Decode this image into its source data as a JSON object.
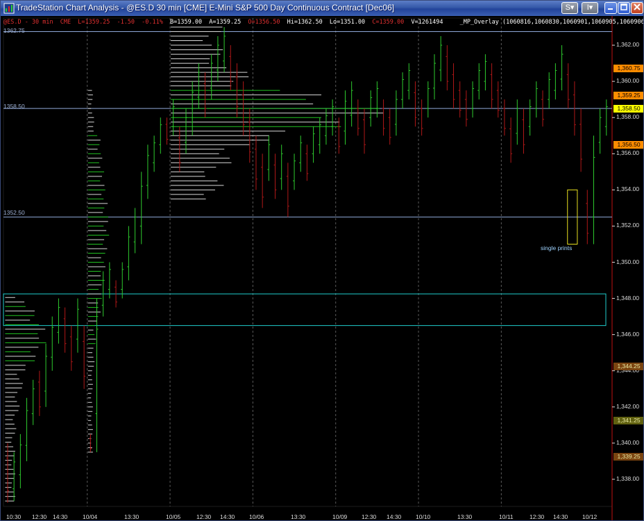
{
  "window": {
    "title": "TradeStation Chart Analysis - @ES.D  30 min  [CME] E-Mini S&P 500 Day Continuous Contract [Dec06]",
    "buttons": {
      "s_label": "S",
      "i_label": "I"
    }
  },
  "infobar": {
    "symbol": "@ES.D - 30 min",
    "exchange": "CME",
    "last": "L=1359.25",
    "change": "-1.50",
    "change_pct": "-0.11%",
    "bid": "B=1359.00",
    "ask": "A=1359.25",
    "open": "O=1356.50",
    "high": "Hi=1362.50",
    "low": "Lo=1351.00",
    "close": "C=1359.00",
    "volume": "V=1261494",
    "indicator": "_MP_Overlay  (1060816,1060830,1060901,1060905,1060906)"
  },
  "annotations": {
    "hline_labels": [
      "1362.75",
      "1358.50",
      "1352.50"
    ],
    "single_prints": "single prints"
  },
  "colors": {
    "up_bar": "#2ecc2e",
    "down_bar": "#b01818",
    "profile_gray": "#d8d8d8",
    "profile_green": "#22c422",
    "hline": "#8fa8d8",
    "box_cyan": "#1fcfcf",
    "box_yellow": "#e8e020",
    "tag_orange": "#ff8c00",
    "tag_yellow": "#ffff00",
    "tag_olive": "#606010",
    "tag_brown": "#7a4410"
  },
  "chart_data": {
    "type": "candlestick",
    "ylim": [
      1336.5,
      1363.5
    ],
    "y_ticks": [
      "1,362.00",
      "1,360.00",
      "1,358.00",
      "1,356.00",
      "1,354.00",
      "1,352.00",
      "1,350.00",
      "1,348.00",
      "1,346.00",
      "1,344.00",
      "1,342.00",
      "1,340.00",
      "1,338.00"
    ],
    "x_ticks": [
      "10:30",
      "12:30",
      "14:30",
      "10/04",
      "13:30",
      "10/05",
      "12:30",
      "14:30",
      "10/06",
      "13:30",
      "10/09",
      "12:30",
      "14:30",
      "10/10",
      "13:30",
      "10/11",
      "12:30",
      "14:30",
      "10/12"
    ],
    "day_separators": [
      "10/04",
      "10/05",
      "10/06",
      "10/09",
      "10/10",
      "10/11"
    ],
    "horizontal_lines": [
      1362.75,
      1358.5,
      1352.5
    ],
    "price_tags": [
      {
        "label": "1,360.75",
        "value": 1360.75,
        "color": "orange"
      },
      {
        "label": "1,359.25",
        "value": 1359.25,
        "color": "orange"
      },
      {
        "label": "1,358.50",
        "value": 1358.5,
        "color": "yellow"
      },
      {
        "label": "1,356.50",
        "value": 1356.5,
        "color": "orange"
      },
      {
        "label": "1,344.25",
        "value": 1344.25,
        "color": "brown"
      },
      {
        "label": "1,341.25",
        "value": 1341.25,
        "color": "olive"
      },
      {
        "label": "1,339.25",
        "value": 1339.25,
        "color": "brown"
      }
    ],
    "zones": [
      {
        "kind": "cyan",
        "y_low": 1346.5,
        "y_high": 1348.25,
        "bar_from": 0,
        "bar_to": 96
      },
      {
        "kind": "single-prints",
        "y_low": 1351.0,
        "y_high": 1354.0,
        "bar_from": 88,
        "bar_to": 89
      }
    ],
    "bars": [
      {
        "h": 1340,
        "l": 1336.7,
        "d": -1
      },
      {
        "h": 1339.5,
        "l": 1336.8,
        "d": 1
      },
      {
        "h": 1340.5,
        "l": 1337.5,
        "d": 1
      },
      {
        "h": 1342.5,
        "l": 1339,
        "d": 1
      },
      {
        "h": 1343.5,
        "l": 1341,
        "d": 1
      },
      {
        "h": 1344,
        "l": 1341.5,
        "d": -1
      },
      {
        "h": 1345.5,
        "l": 1342,
        "d": 1
      },
      {
        "h": 1347,
        "l": 1344,
        "d": 1
      },
      {
        "h": 1348,
        "l": 1345.5,
        "d": 1
      },
      {
        "h": 1347.5,
        "l": 1345,
        "d": -1
      },
      {
        "h": 1346.5,
        "l": 1344,
        "d": -1
      },
      {
        "h": 1348,
        "l": 1345,
        "d": 1
      },
      {
        "h": 1346.5,
        "l": 1343,
        "d": -1
      },
      {
        "h": 1340.5,
        "l": 1339.5,
        "d": -1
      },
      {
        "h": 1348,
        "l": 1339.5,
        "d": 1
      },
      {
        "h": 1349.5,
        "l": 1347,
        "d": 1
      },
      {
        "h": 1350,
        "l": 1348,
        "d": 1
      },
      {
        "h": 1349,
        "l": 1347.5,
        "d": -1
      },
      {
        "h": 1350,
        "l": 1348,
        "d": 1
      },
      {
        "h": 1352,
        "l": 1349,
        "d": 1
      },
      {
        "h": 1353,
        "l": 1350.5,
        "d": 1
      },
      {
        "h": 1355,
        "l": 1351,
        "d": 1
      },
      {
        "h": 1356.5,
        "l": 1353.5,
        "d": 1
      },
      {
        "h": 1357,
        "l": 1355,
        "d": 1
      },
      {
        "h": 1358,
        "l": 1356,
        "d": 1
      },
      {
        "h": 1358,
        "l": 1356.5,
        "d": -1
      },
      {
        "h": 1359,
        "l": 1357,
        "d": 1
      },
      {
        "h": 1357.5,
        "l": 1355,
        "d": -1
      },
      {
        "h": 1358.5,
        "l": 1356,
        "d": 1
      },
      {
        "h": 1360,
        "l": 1357,
        "d": 1
      },
      {
        "h": 1361,
        "l": 1358.5,
        "d": 1
      },
      {
        "h": 1360.5,
        "l": 1358,
        "d": -1
      },
      {
        "h": 1361.5,
        "l": 1359,
        "d": 1
      },
      {
        "h": 1362.5,
        "l": 1360,
        "d": 1
      },
      {
        "h": 1363,
        "l": 1360.5,
        "d": 1
      },
      {
        "h": 1362,
        "l": 1359.5,
        "d": -1
      },
      {
        "h": 1361,
        "l": 1358,
        "d": -1
      },
      {
        "h": 1360,
        "l": 1357,
        "d": -1
      },
      {
        "h": 1358.5,
        "l": 1355.5,
        "d": -1
      },
      {
        "h": 1357,
        "l": 1354,
        "d": -1
      },
      {
        "h": 1356,
        "l": 1353,
        "d": -1
      },
      {
        "h": 1357,
        "l": 1354.5,
        "d": 1
      },
      {
        "h": 1356,
        "l": 1353.5,
        "d": -1
      },
      {
        "h": 1356.5,
        "l": 1354,
        "d": 1
      },
      {
        "h": 1355.5,
        "l": 1352.5,
        "d": -1
      },
      {
        "h": 1356,
        "l": 1354,
        "d": 1
      },
      {
        "h": 1357,
        "l": 1355,
        "d": 1
      },
      {
        "h": 1356.5,
        "l": 1354.5,
        "d": -1
      },
      {
        "h": 1357.5,
        "l": 1355.5,
        "d": 1
      },
      {
        "h": 1358,
        "l": 1356,
        "d": 1
      },
      {
        "h": 1358.5,
        "l": 1356.5,
        "d": 1
      },
      {
        "h": 1359,
        "l": 1357,
        "d": 1
      },
      {
        "h": 1358,
        "l": 1356,
        "d": -1
      },
      {
        "h": 1359.5,
        "l": 1356.5,
        "d": 1
      },
      {
        "h": 1360,
        "l": 1357.5,
        "d": 1
      },
      {
        "h": 1359,
        "l": 1357,
        "d": -1
      },
      {
        "h": 1358.5,
        "l": 1356,
        "d": -1
      },
      {
        "h": 1359.5,
        "l": 1357.5,
        "d": 1
      },
      {
        "h": 1360,
        "l": 1358,
        "d": 1
      },
      {
        "h": 1359,
        "l": 1357,
        "d": -1
      },
      {
        "h": 1358.5,
        "l": 1356.5,
        "d": -1
      },
      {
        "h": 1359.5,
        "l": 1357,
        "d": 1
      },
      {
        "h": 1360.5,
        "l": 1358.5,
        "d": 1
      },
      {
        "h": 1361,
        "l": 1359,
        "d": 1
      },
      {
        "h": 1360,
        "l": 1357.5,
        "d": -1
      },
      {
        "h": 1359,
        "l": 1357,
        "d": -1
      },
      {
        "h": 1360,
        "l": 1358,
        "d": 1
      },
      {
        "h": 1361.5,
        "l": 1359,
        "d": 1
      },
      {
        "h": 1362.5,
        "l": 1360,
        "d": 1
      },
      {
        "h": 1362,
        "l": 1359.5,
        "d": -1
      },
      {
        "h": 1361,
        "l": 1358.5,
        "d": -1
      },
      {
        "h": 1360,
        "l": 1358,
        "d": -1
      },
      {
        "h": 1359.5,
        "l": 1357.5,
        "d": -1
      },
      {
        "h": 1360,
        "l": 1358,
        "d": 1
      },
      {
        "h": 1361,
        "l": 1359,
        "d": 1
      },
      {
        "h": 1361.5,
        "l": 1359.5,
        "d": 1
      },
      {
        "h": 1361,
        "l": 1358.5,
        "d": -1
      },
      {
        "h": 1360,
        "l": 1358,
        "d": -1
      },
      {
        "h": 1359,
        "l": 1357,
        "d": -1
      },
      {
        "h": 1358,
        "l": 1355.5,
        "d": -1
      },
      {
        "h": 1359,
        "l": 1356.5,
        "d": 1
      },
      {
        "h": 1358.5,
        "l": 1356,
        "d": -1
      },
      {
        "h": 1359,
        "l": 1357,
        "d": 1
      },
      {
        "h": 1360,
        "l": 1358,
        "d": 1
      },
      {
        "h": 1359.5,
        "l": 1357.5,
        "d": -1
      },
      {
        "h": 1360.5,
        "l": 1358.5,
        "d": 1
      },
      {
        "h": 1361,
        "l": 1359,
        "d": 1
      },
      {
        "h": 1362,
        "l": 1359.5,
        "d": 1
      },
      {
        "h": 1361,
        "l": 1358.5,
        "d": -1
      },
      {
        "h": 1360,
        "l": 1357,
        "d": -1
      },
      {
        "h": 1358.5,
        "l": 1355,
        "d": -1
      },
      {
        "h": 1354,
        "l": 1351,
        "d": -1
      },
      {
        "h": 1357,
        "l": 1351,
        "d": 1
      },
      {
        "h": 1358.5,
        "l": 1356,
        "d": 1
      },
      {
        "h": 1359,
        "l": 1357,
        "d": 1
      }
    ],
    "profiles": [
      {
        "x_bar": 0,
        "y_low": 1336.8,
        "y_high": 1348.2,
        "dense_low": 1344.0,
        "dense_high": 1347.8,
        "max_len": 65,
        "green_low": 1344.5,
        "green_high": 1347.6
      },
      {
        "x_bar": 13,
        "y_low": 1339.5,
        "y_high": 1359.5,
        "dense_low": 1347.0,
        "dense_high": 1357.0,
        "max_len": 32,
        "green_low": 1345.2,
        "green_high": 1357.2
      },
      {
        "x_bar": 26,
        "y_low": 1353.5,
        "y_high": 1363.2,
        "dense_low": 1357.0,
        "dense_high": 1359.5,
        "max_len": 340,
        "green_low": 1357.2,
        "green_high": 1359.8
      }
    ]
  }
}
